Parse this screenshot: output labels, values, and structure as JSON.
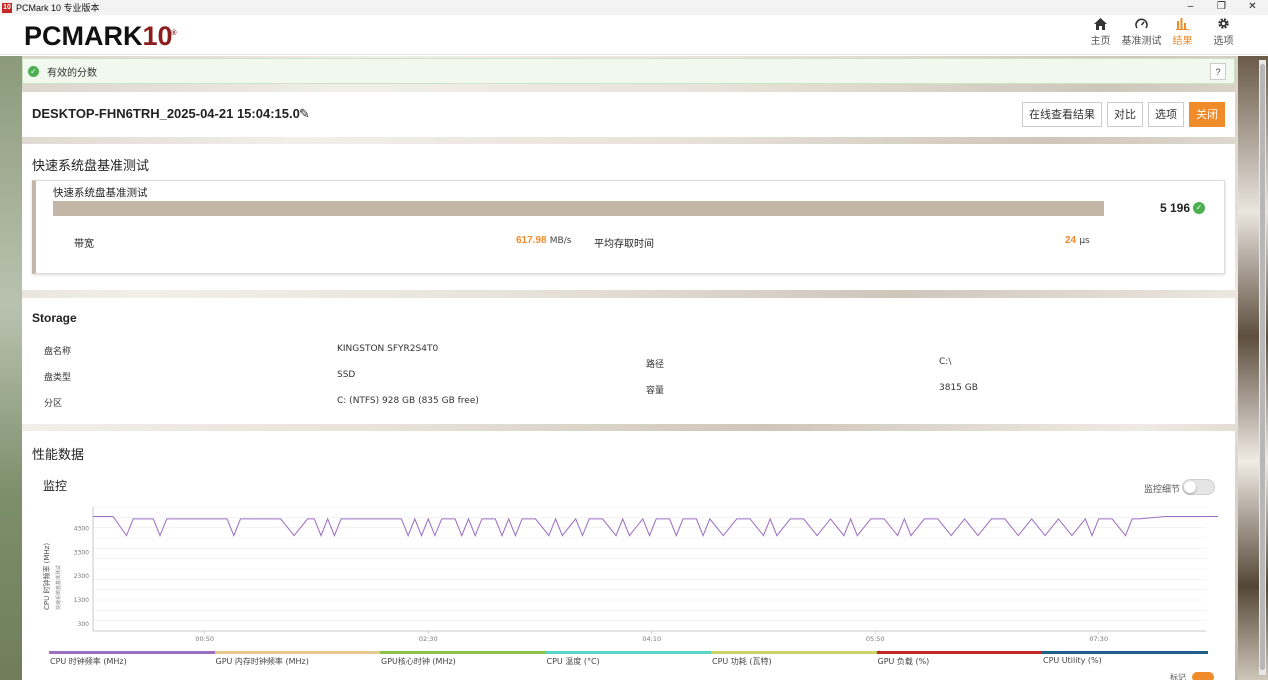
{
  "window": {
    "title": "PCMark 10 专业版本",
    "icon_text": "10",
    "controls": [
      "–",
      "❐",
      "✕"
    ]
  },
  "header": {
    "logo_main": "PCMARK",
    "logo_num": "10",
    "nav": [
      {
        "label": "主页",
        "icon": "home-icon"
      },
      {
        "label": "基准测试",
        "icon": "gauge-icon"
      },
      {
        "label": "结果",
        "icon": "bar-chart-icon",
        "active": true
      },
      {
        "label": "选项",
        "icon": "gear-icon"
      }
    ]
  },
  "valid": {
    "text": "有效的分数",
    "help": "?"
  },
  "result": {
    "title": "DESKTOP-FHN6TRH_2025-04-21 15:04:15.0",
    "buttons": {
      "online": "在线查看结果",
      "compare": "对比",
      "options": "选项",
      "close": "关闭"
    }
  },
  "test": {
    "section_title": "快速系统盘基准测试",
    "card_title": "快速系统盘基准测试",
    "score": "5 196",
    "bandwidth": {
      "label": "带宽",
      "value": "617.98",
      "unit": "MB/s"
    },
    "access_time": {
      "label": "平均存取时间",
      "value": "24",
      "unit": "µs"
    }
  },
  "storage": {
    "title": "Storage",
    "rows": {
      "disk_name_label": "盘名称",
      "disk_name_value": "KINGSTON SFYR2S4T0",
      "disk_type_label": "盘类型",
      "disk_type_value": "SSD",
      "partition_label": "分区",
      "partition_value": "C: (NTFS) 928 GB (835 GB free)",
      "path_label": "路径",
      "path_value": "C:\\",
      "capacity_label": "容量",
      "capacity_value": "3815 GB"
    }
  },
  "perf": {
    "title": "性能数据",
    "monitor": "监控",
    "details_toggle": "监控细节",
    "marker_toggle": "标记",
    "legend": [
      {
        "label": "CPU 时钟频率 (MHz)",
        "color": "#9b6fc1"
      },
      {
        "label": "GPU 内存时钟频率 (MHz)",
        "color": "#e6c98e"
      },
      {
        "label": "GPU核心时钟 (MHz)",
        "color": "#8bc34a"
      },
      {
        "label": "CPU 温度 (°C)",
        "color": "#5ad6c8"
      },
      {
        "label": "CPU 功耗 (瓦特)",
        "color": "#cdd36b"
      },
      {
        "label": "GPU 负载 (%)",
        "color": "#c62828"
      },
      {
        "label": "CPU Utility (%)",
        "color": "#1f5f8b"
      }
    ]
  },
  "chart_data": {
    "type": "line",
    "ylabel": "CPU 时钟频率 (MHz)",
    "ylabel2": "快速系统盘基准测试",
    "yticks": [
      "4300",
      "3300",
      "2300",
      "1300",
      "300"
    ],
    "xticks": [
      "00:50",
      "02:30",
      "04:10",
      "05:50",
      "07:30"
    ],
    "series": [
      {
        "name": "CPU 时钟频率 (MHz)",
        "color": "#9b6fc1",
        "x": [
          0,
          0.15,
          0.25,
          0.3,
          0.45,
          0.5,
          0.55,
          1.0,
          1.05,
          1.1,
          1.4,
          1.5,
          1.6,
          1.65,
          1.7,
          1.75,
          1.8,
          1.85,
          1.9,
          2.3,
          2.35,
          2.4,
          2.45,
          2.5,
          2.55,
          2.6,
          2.7,
          2.75,
          2.8,
          2.85,
          2.9,
          3.0,
          3.05,
          3.1,
          3.15,
          3.2,
          3.3,
          3.4,
          3.45,
          3.5,
          3.6,
          3.65,
          3.7,
          3.8,
          3.9,
          3.95,
          4.0,
          4.1,
          4.15,
          4.2,
          4.3,
          4.35,
          4.4,
          4.5,
          4.55,
          4.6,
          4.7,
          4.8,
          4.9,
          5.0,
          5.05,
          5.1,
          5.2,
          5.3,
          5.4,
          5.5,
          5.6,
          5.65,
          5.7,
          5.8,
          5.9,
          6.0,
          6.05,
          6.1,
          6.2,
          6.3,
          6.4,
          6.5,
          6.6,
          6.7,
          6.8,
          6.9,
          7.0,
          7.1,
          7.2,
          7.3,
          7.4,
          7.45,
          7.5,
          7.6,
          7.7,
          7.75,
          7.8,
          8.0,
          8.5,
          9.0,
          9.3
        ],
        "y": [
          4800,
          4800,
          4000,
          4700,
          4700,
          4000,
          4700,
          4700,
          4000,
          4700,
          4700,
          4000,
          4700,
          4700,
          4000,
          4700,
          4000,
          4700,
          4700,
          4700,
          4000,
          4700,
          4000,
          4700,
          4000,
          4700,
          4700,
          4000,
          4700,
          4000,
          4700,
          4700,
          4000,
          4700,
          4000,
          4700,
          4700,
          4000,
          4700,
          4000,
          4700,
          4000,
          4700,
          4700,
          4000,
          4700,
          4000,
          4700,
          4000,
          4700,
          4700,
          4000,
          4700,
          4700,
          4000,
          4700,
          4000,
          4700,
          4700,
          4000,
          4700,
          4000,
          4700,
          4700,
          4000,
          4700,
          4000,
          4700,
          4000,
          4700,
          4700,
          4000,
          4700,
          4000,
          4700,
          4700,
          4000,
          4700,
          4000,
          4700,
          4700,
          4000,
          4700,
          4000,
          4700,
          4000,
          4700,
          4000,
          4700,
          4700,
          4000,
          4700,
          4700,
          4800,
          4800,
          4800,
          4800
        ],
        "xmax": 9.3,
        "ylim": [
          0,
          5200
        ]
      }
    ]
  }
}
